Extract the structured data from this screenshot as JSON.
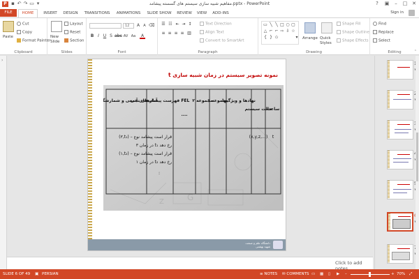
{
  "window": {
    "title": "مفاهیم شبیه سازی سیستم های گسسته پیشامد.pptx - PowerPoint",
    "app_icon": "P",
    "help": "?",
    "minimize": "–",
    "maximize": "□",
    "close": "✕"
  },
  "tabs": [
    "FILE",
    "HOME",
    "INSERT",
    "DESIGN",
    "TRANSITIONS",
    "ANIMATIONS",
    "SLIDE SHOW",
    "REVIEW",
    "VIEW",
    "ADD-INS"
  ],
  "signin": "Sign in",
  "ribbon": {
    "clipboard": {
      "label": "Clipboard",
      "paste": "Paste",
      "cut": "Cut",
      "copy": "Copy",
      "format_painter": "Format Painter"
    },
    "slides": {
      "label": "Slides",
      "new_slide": "New Slide",
      "layout": "Layout",
      "reset": "Reset",
      "section": "Section"
    },
    "font": {
      "label": "Font",
      "size": "12",
      "bold": "B",
      "italic": "I",
      "underline": "U",
      "strike": "S",
      "spacing": "AV",
      "case": "Aa",
      "grow": "A",
      "shrink": "A"
    },
    "paragraph": {
      "label": "Paragraph",
      "text_direction": "Text Direction",
      "align_text": "Align Text",
      "convert_smartart": "Convert to SmartArt"
    },
    "drawing": {
      "label": "Drawing",
      "arrange": "Arrange",
      "quick_styles": "Quick Styles",
      "shape_fill": "Shape Fill",
      "shape_outline": "Shape Outline",
      "shape_effects": "Shape Effects"
    },
    "editing": {
      "label": "Editing",
      "find": "Find",
      "replace": "Replace",
      "select": "Select"
    }
  },
  "slide": {
    "title": "نمونه تصویر سیستم در زمان شبیه سازی t",
    "table_headers": [
      "ساعت",
      "حالت سیستم",
      "نهادها و ویژگیها",
      "مجموعه ۱",
      "مجموعه ۲",
      "....",
      "فهرست پیشامدهای آتی FEL",
      "آمارهای تجمعی و شمارشگرها"
    ],
    "table_cells": {
      "clock": "t",
      "state": "(x,y,z,…)",
      "fel_1": "(۳,t₁) – قرار است پیشامد نوع",
      "fel_2": "۳ در زمان t₁ رخ دهد",
      "fel_3": "(۱,t₂) – قرار است پیشامد نوع",
      "fel_4": "۱ در زمان t₂ رخ دهد",
      "fel_dots": ":"
    },
    "footer_text_1": "دانشگاه علم و صنعت",
    "footer_text_2": "شهید بهشتی"
  },
  "notes_placeholder": "Click to add notes",
  "thumbnails": [
    {
      "num": "1",
      "star": "★"
    },
    {
      "num": "2",
      "star": "★"
    },
    {
      "num": "3",
      "star": "★"
    },
    {
      "num": "4",
      "star": "★"
    },
    {
      "num": "5",
      "star": "★"
    },
    {
      "num": "6",
      "star": "★"
    },
    {
      "num": "7",
      "star": "★"
    }
  ],
  "status": {
    "slide_indicator": "SLIDE 6 OF 49",
    "language": "PERSIAN",
    "notes": "NOTES",
    "comments": "COMMENTS",
    "zoom": "70%"
  },
  "colors": {
    "accent": "#d24726",
    "title_red": "#c00000"
  }
}
